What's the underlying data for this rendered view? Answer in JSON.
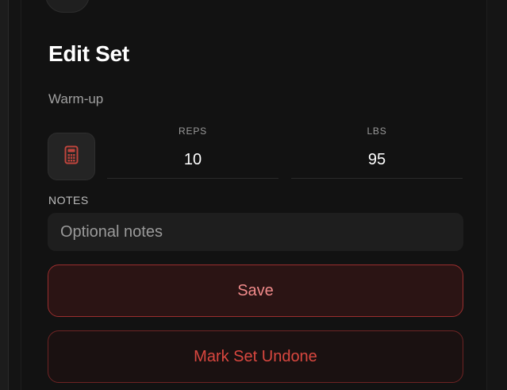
{
  "dialog": {
    "title": "Edit Set",
    "subtitle": "Warm-up"
  },
  "fields": {
    "reps": {
      "label": "REPS",
      "value": "10"
    },
    "lbs": {
      "label": "LBS",
      "value": "95"
    }
  },
  "notes": {
    "label": "NOTES",
    "placeholder": "Optional notes",
    "value": ""
  },
  "buttons": {
    "save_label": "Save",
    "undone_label": "Mark Set Undone"
  },
  "icons": {
    "calculator": "calculator-icon"
  },
  "colors": {
    "accent": "#d9473f",
    "save_text": "#f08a8a",
    "background": "#121212"
  }
}
